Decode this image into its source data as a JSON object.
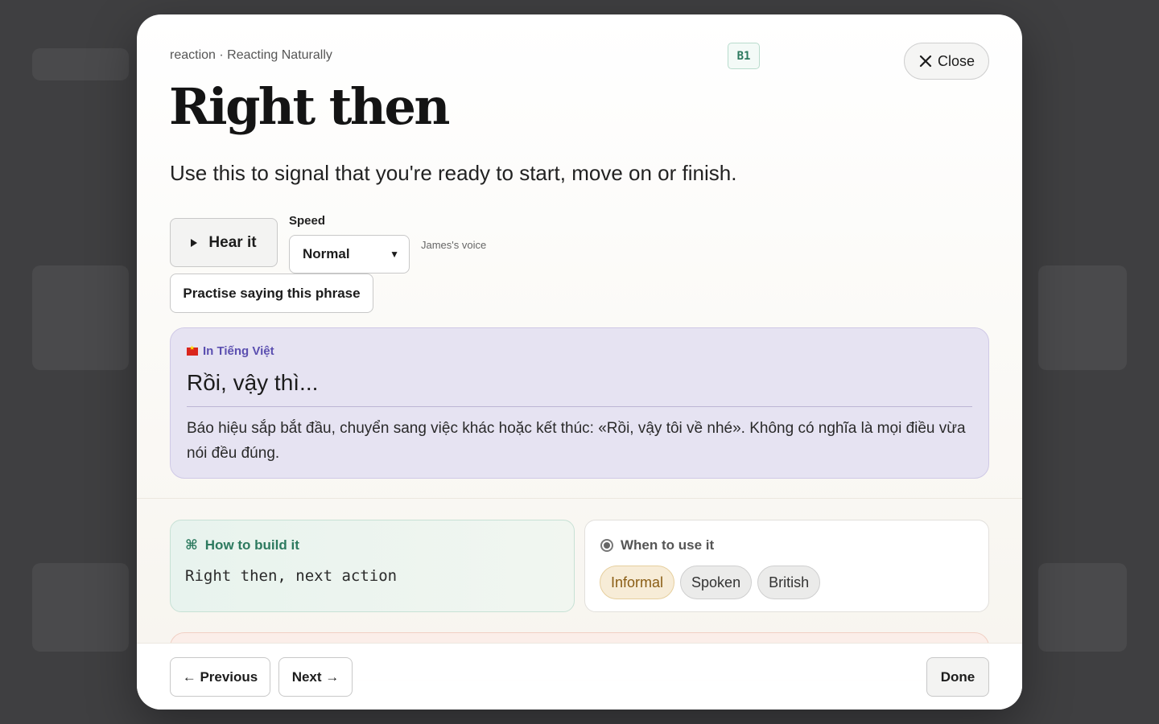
{
  "header": {
    "breadcrumb": "reaction · Reacting Naturally",
    "level": "B1",
    "close_label": "Close"
  },
  "phrase": {
    "title": "Right then",
    "description": "Use this to signal that you're ready to start, move on or finish."
  },
  "audio": {
    "hear_label": "Hear it",
    "speed_label": "Speed",
    "speed_value": "Normal",
    "voice": "James's voice",
    "practise_label": "Practise saying this phrase"
  },
  "translation": {
    "label": "In Tiếng Việt",
    "phrase": "Rồi, vậy thì...",
    "explanation": "Báo hiệu sắp bắt đầu, chuyển sang việc khác hoặc kết thúc: «Rồi, vậy tôi về nhé». Không có nghĩa là mọi điều vừa nói đều đúng."
  },
  "build": {
    "title": "How to build it",
    "icon": "command-icon",
    "pattern": "Right then, next action"
  },
  "usage": {
    "title": "When to use it",
    "tags": [
      "Informal",
      "Spoken",
      "British"
    ]
  },
  "footer": {
    "previous_label": "← Previous",
    "next_label": "Next →",
    "done_label": "Done"
  }
}
